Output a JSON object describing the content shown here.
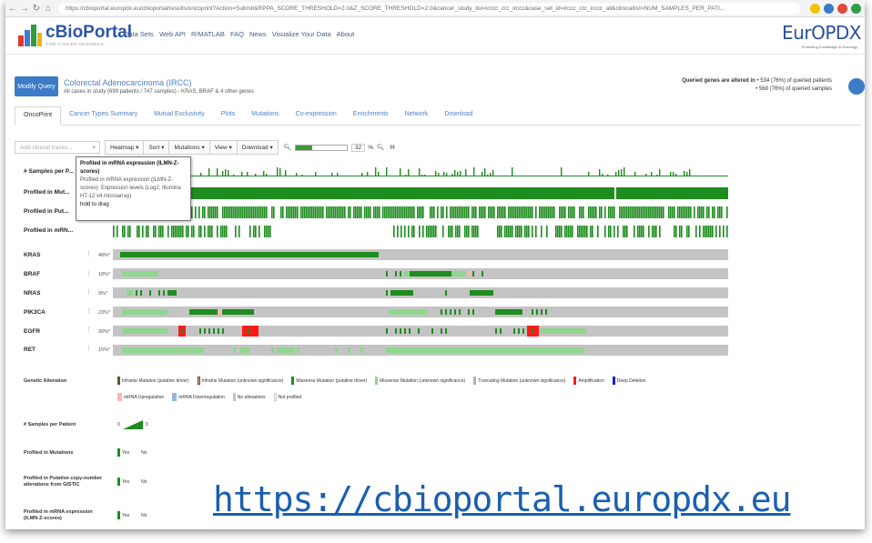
{
  "browser": {
    "url": "https://cbioportal.europdx.eu/cbioportal/results/oncoprint?Action=Submit&RPPA_SCORE_THRESHOLD=2.0&Z_SCORE_THRESHOLD=2.0&cancer_study_list=irccc_crc_irccc&case_set_id=irccc_crc_irccc_all&clinicallist=NUM_SAMPLES_PER_PATI..."
  },
  "header": {
    "logo_title": "cBioPortal",
    "logo_subtitle": "FOR CANCER GENOMICS",
    "nav": [
      "Data Sets",
      "Web API",
      "R/MATLAB",
      "FAQ",
      "News",
      "Visualize Your Data",
      "About"
    ],
    "partner_logo": "EurOPDX",
    "partner_tagline": "Promoting Knowledge in Oncology"
  },
  "query": {
    "button": "Modify Query",
    "study_title": "Colorectal Adenocarcinoma (IRCC)",
    "study_subtitle": "All cases in study (699 patients / 747 samples) - KRAS, BRAF & 4 other genes",
    "altered_prefix": "Queried genes are altered in",
    "altered_patients": "• 534 (76%) of queried patients",
    "altered_samples": "• 568 (76%) of queried samples"
  },
  "tabs": [
    "OncoPrint",
    "Cancer Types Summary",
    "Mutual Exclusivity",
    "Plots",
    "Mutations",
    "Co-expression",
    "Enrichments",
    "Network",
    "Download"
  ],
  "toolbar": {
    "clinical_placeholder": "Add clinical tracks...",
    "buttons": [
      "Heatmap ▾",
      "Sort ▾",
      "Mutations ▾",
      "View ▾",
      "Download ▾"
    ],
    "zoom_percent": "32",
    "zoom_unit": "%",
    "zoom_fraction": 0.32
  },
  "clinical_tracks": [
    {
      "label": "# Samples per P..."
    },
    {
      "label": "Profiled in Mut..."
    },
    {
      "label": "Profiled in Put..."
    },
    {
      "label": "Profiled in mRN..."
    }
  ],
  "genes": [
    {
      "name": "KRAS",
      "pct": "48%*"
    },
    {
      "name": "BRAF",
      "pct": "18%*"
    },
    {
      "name": "NRAS",
      "pct": "9%*"
    },
    {
      "name": "PIK3CA",
      "pct": "23%*"
    },
    {
      "name": "EGFR",
      "pct": "30%*"
    },
    {
      "name": "RET",
      "pct": "15%*"
    }
  ],
  "tooltip": {
    "title": "Profiled in mRNA expression (ILMN-Z-scores)",
    "body": "Profiled in mRNA expression (ILMN-Z-scores): Expression levels (Log2, Illumina HT-12 v4 microarray)",
    "hint": "hold to drag"
  },
  "legend": {
    "genetic_title": "Genetic Alteration",
    "genetic_items": [
      "Inframe Mutation (putative driver)",
      "Inframe Mutation (unknown significance)",
      "Missense Mutation (putative driver)",
      "Missense Mutation (unknown significance)",
      "Truncating Mutation (unknown significance)",
      "Amplification",
      "Deep Deletion"
    ],
    "genetic_items2": [
      "mRNA Upregulation",
      "mRNA Downregulation",
      "No alterations",
      "Not profiled"
    ],
    "samples_title": "# Samples per Patient",
    "samples_min": "0",
    "samples_max": "3",
    "profiled": [
      {
        "title": "Profiled in Mutations",
        "yes": "Yes",
        "no": "No"
      },
      {
        "title": "Profiled in Putative copy-number alterations from GISTIC",
        "yes": "Yes",
        "no": "No"
      },
      {
        "title": "Profiled in mRNA expression (ILMN-Z-scores)",
        "yes": "Yes",
        "no": "No"
      }
    ]
  },
  "bottom_link": "https://cbioportal.europdx.eu",
  "colors": {
    "driver_green": "#1e8c1e",
    "vus_green": "#8fd68f",
    "amplification": "#ff1a1a",
    "deep_deletion": "#1a1ad8",
    "mrna_up": "#ffb3b3",
    "mrna_down": "#9ab4e0",
    "no_alteration": "#c4c4c4",
    "link_blue": "#1a5fb0"
  }
}
